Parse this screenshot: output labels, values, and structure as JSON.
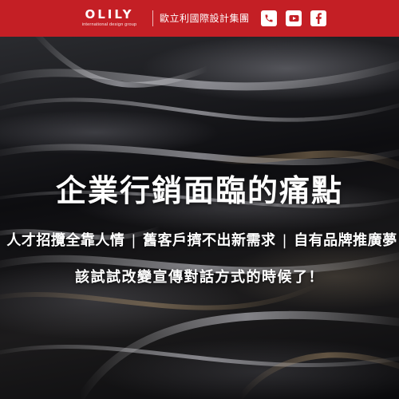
{
  "header": {
    "logo_text": "OLILY",
    "logo_subtext": "international design group",
    "company_name": "歐立利國際設計集團",
    "brand_color": "#c41f25",
    "icons": [
      "phone-icon",
      "youtube-icon",
      "facebook-icon"
    ]
  },
  "hero": {
    "headline": "企業行銷面臨的痛點",
    "pain_points": [
      "人才招攬全靠人情",
      "舊客戶擠不出新需求",
      "自有品牌推廣夢"
    ],
    "separator": "|",
    "subheadline": "該試試改變宣傳對話方式的時候了！"
  }
}
